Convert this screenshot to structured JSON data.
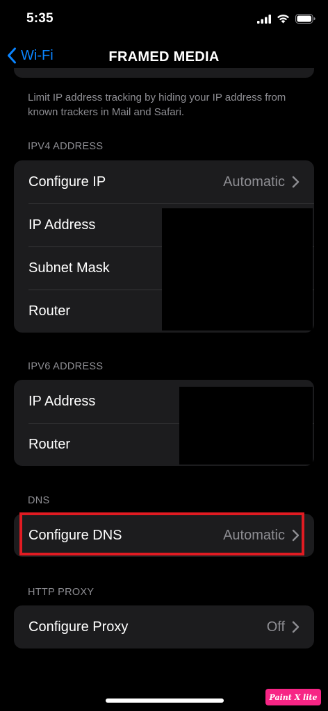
{
  "status_bar": {
    "time": "5:35",
    "icons": [
      "cellular-signal-icon",
      "wifi-icon",
      "battery-icon"
    ]
  },
  "nav": {
    "back_label": "Wi-Fi",
    "title": "FRAMED MEDIA"
  },
  "privacy_footer": "Limit IP address tracking by hiding your IP address from known trackers in Mail and Safari.",
  "ipv4": {
    "header": "IPV4 ADDRESS",
    "rows": [
      {
        "label": "Configure IP",
        "value": "Automatic"
      },
      {
        "label": "IP Address"
      },
      {
        "label": "Subnet Mask"
      },
      {
        "label": "Router"
      }
    ]
  },
  "ipv6": {
    "header": "IPV6 ADDRESS",
    "rows": [
      {
        "label": "IP Address"
      },
      {
        "label": "Router"
      }
    ]
  },
  "dns": {
    "header": "DNS",
    "rows": [
      {
        "label": "Configure DNS",
        "value": "Automatic"
      }
    ]
  },
  "http_proxy": {
    "header": "HTTP PROXY",
    "rows": [
      {
        "label": "Configure Proxy",
        "value": "Off"
      }
    ]
  },
  "watermark": "Paint X lite",
  "colors": {
    "background": "#000000",
    "card": "#1c1c1e",
    "separator": "#38383a",
    "secondary_text": "#8e8e93",
    "accent": "#0a84ff",
    "highlight": "#e11b22",
    "watermark": "#f72585"
  }
}
